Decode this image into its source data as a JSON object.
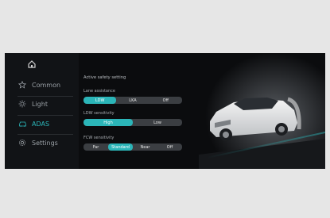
{
  "sidebar": {
    "items": [
      {
        "label": "Common",
        "icon": "star-icon"
      },
      {
        "label": "Light",
        "icon": "sun-icon"
      },
      {
        "label": "ADAS",
        "icon": "adas-car-icon"
      },
      {
        "label": "Settings",
        "icon": "gear-icon"
      }
    ],
    "active": "ADAS"
  },
  "panel": {
    "title": "Active safety setting",
    "lane_assistance": {
      "label": "Lane assistance",
      "options": [
        "LDW",
        "LKA",
        "Off"
      ],
      "selected": "LDW"
    },
    "ldw_sensitivity": {
      "label": "LDW  sensitivity",
      "options": [
        "High",
        "Low"
      ],
      "selected": "High"
    },
    "fcw_sensitivity": {
      "label": "FCW sensitivity",
      "options": [
        "Far",
        "Standard",
        "Near",
        "Off"
      ],
      "selected": "Standard"
    }
  },
  "colors": {
    "accent": "#2bb5b8",
    "background": "#0b0c0e",
    "segment_bg": "#3b3e42"
  }
}
